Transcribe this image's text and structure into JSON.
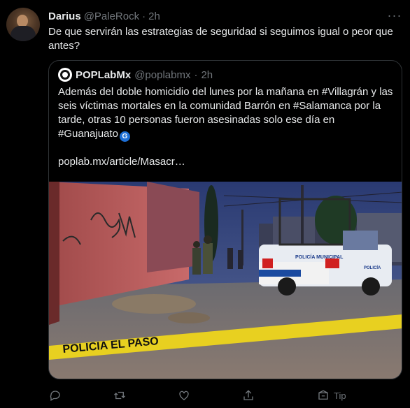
{
  "author": {
    "name": "Darius",
    "handle": "@PaleRock",
    "separator": "·",
    "time": "2h"
  },
  "tweet_text": "De que servirán las estrategias de seguridad si seguimos igual o peor que antes?",
  "quoted": {
    "name": "POPLabMx",
    "handle": "@poplabmx",
    "separator": "·",
    "time": "2h",
    "text_1": "Además del doble homicidio del lunes por la mañana en ",
    "tag_1": "#Villagrán",
    "text_2": " y las seis víctimas mortales en la comunidad Barrón en ",
    "tag_2": "#Salamanca",
    "text_3": " por la tarde, otras 10 personas fueron asesinadas solo ese día en ",
    "tag_3": "#Guanajuato",
    "emoji": "G",
    "link": "poplab.mx/article/Masacr…",
    "photo": {
      "tape_text": "POLICIA EL PASO",
      "truck_text": "POLICÍA MUNICIPAL",
      "truck_side": "POLICÍA"
    }
  },
  "actions": {
    "tip_label": "Tip"
  },
  "more_label": "···",
  "colors": {
    "background": "#000000",
    "text": "#e7e9ea",
    "muted": "#71767b",
    "border": "#2f3336"
  }
}
